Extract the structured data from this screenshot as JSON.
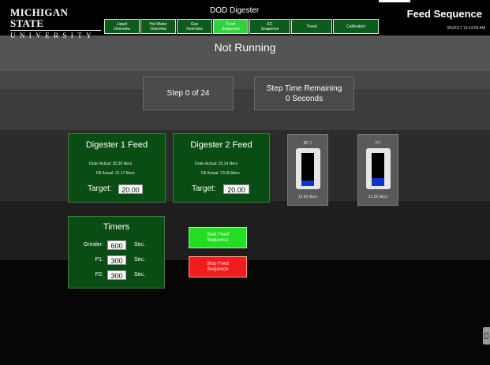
{
  "header": {
    "logo_top": "MICHIGAN STATE",
    "logo_bottom": "UNIVERSITY",
    "app_title": "DOD Digester",
    "screen_title": "Feed Sequence",
    "datetime": "3/5/2017 10:14:59 AM"
  },
  "nav": [
    {
      "label": "Liquid\nOverview"
    },
    {
      "label": "Hot Water\nOverview"
    },
    {
      "label": "Gas\nOverview"
    },
    {
      "label": "Feed\nSequence"
    },
    {
      "label": "EC\nSequence"
    },
    {
      "label": "Trend"
    },
    {
      "label": "Calibration"
    }
  ],
  "status": "Not Running",
  "step": "Step 0 of 24",
  "step_time": {
    "line1": "Step Time Remaining",
    "line2": "0 Seconds"
  },
  "digester1": {
    "title": "Digester 1 Feed",
    "drain_actual": "Drain Actual: 20.30 liters",
    "fill_actual": "Fill Actual: 21.17 liters",
    "target_label": "Target:",
    "target_value": "20.00"
  },
  "digester2": {
    "title": "Digester 2 Feed",
    "drain_actual": "Drain Actual: 20.14 liters",
    "fill_actual": "Fill Actual: 23.90 liters",
    "target_label": "Target:",
    "target_value": "20.00"
  },
  "tank1": {
    "label": "BF-1",
    "value_text": "13.50 liters",
    "level": 0.16
  },
  "tank2": {
    "label": "FT",
    "value_text": "21.52 liters",
    "level": 0.24
  },
  "timers": {
    "title": "Timers",
    "rows": [
      {
        "label": "Grinder:",
        "value": "600",
        "unit": "Sec."
      },
      {
        "label": "P1:",
        "value": "300",
        "unit": "Sec."
      },
      {
        "label": "P2:",
        "value": "300",
        "unit": "Sec."
      }
    ]
  },
  "buttons": {
    "start": "Start Feed\nSequence",
    "stop": "Stop Feed\nSequence"
  }
}
